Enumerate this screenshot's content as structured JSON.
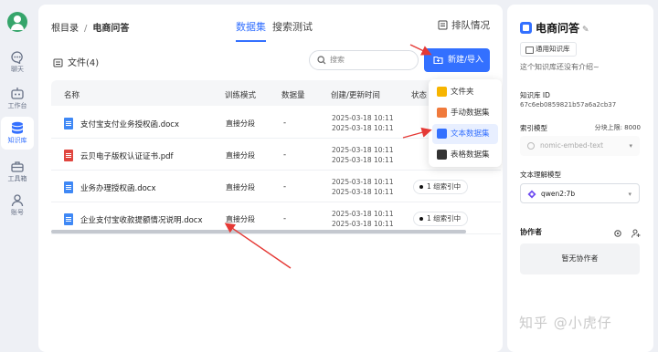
{
  "nav": {
    "items": [
      {
        "label": "聊天",
        "icon": "chat-icon"
      },
      {
        "label": "工作台",
        "icon": "robot-icon"
      },
      {
        "label": "知识库",
        "icon": "database-icon",
        "active": true
      },
      {
        "label": "工具箱",
        "icon": "toolbox-icon"
      },
      {
        "label": "账号",
        "icon": "user-icon"
      }
    ]
  },
  "breadcrumb": {
    "root": "根目录",
    "separator": "/",
    "current": "电商问答"
  },
  "tabs": [
    {
      "label": "数据集",
      "active": true
    },
    {
      "label": "搜索测试",
      "active": false
    }
  ],
  "queue_label": "排队情况",
  "files": {
    "title": "文件(4)",
    "search_placeholder": "搜索",
    "new_button": "新建/导入",
    "columns": [
      "名称",
      "训练模式",
      "数据量",
      "创建/更新时间",
      "状态"
    ],
    "rows": [
      {
        "name": "支付宝支付业务授权函.docx",
        "type": "word",
        "mode": "直接分段",
        "count": "-",
        "created": "2025-03-18 10:11",
        "updated": "2025-03-18 10:11",
        "status": ""
      },
      {
        "name": "云贝电子版权认证证书.pdf",
        "type": "pdf",
        "mode": "直接分段",
        "count": "-",
        "created": "2025-03-18 10:11",
        "updated": "2025-03-18 10:11",
        "status": ""
      },
      {
        "name": "业务办理授权函.docx",
        "type": "word",
        "mode": "直接分段",
        "count": "-",
        "created": "2025-03-18 10:11",
        "updated": "2025-03-18 10:11",
        "status": "1 组索引中"
      },
      {
        "name": "企业支付宝收款提额情况说明.docx",
        "type": "word",
        "mode": "直接分段",
        "count": "-",
        "created": "2025-03-18 10:11",
        "updated": "2025-03-18 10:11",
        "status": "1 组索引中"
      }
    ]
  },
  "dropdown": {
    "items": [
      {
        "label": "文件夹",
        "icon": "folder-icon",
        "color": "#f7b500"
      },
      {
        "label": "手动数据集",
        "icon": "manual-dataset-icon",
        "color": "#f07a3c"
      },
      {
        "label": "文本数据集",
        "icon": "text-dataset-icon",
        "color": "#3370ff",
        "active": true
      },
      {
        "label": "表格数据集",
        "icon": "table-dataset-icon",
        "color": "#333333"
      }
    ]
  },
  "kb": {
    "name": "电商问答",
    "type": "通用知识库",
    "intro": "这个知识库还没有介绍~",
    "id_label": "知识库 ID",
    "id": "67c6eb0859821b57a6a2cb37",
    "index_model_label": "索引模型",
    "chunk_limit": "分块上限: 8000",
    "index_model": "nomic-embed-text",
    "text_model_label": "文本理解模型",
    "text_model": "qwen2:7b",
    "collab_label": "协作者",
    "no_collab": "暂无协作者"
  },
  "watermark": "知乎 @小虎仔",
  "colors": {
    "accent": "#3370ff",
    "page_bg": "#eef0f5",
    "annotation_arrow": "#e53935"
  }
}
